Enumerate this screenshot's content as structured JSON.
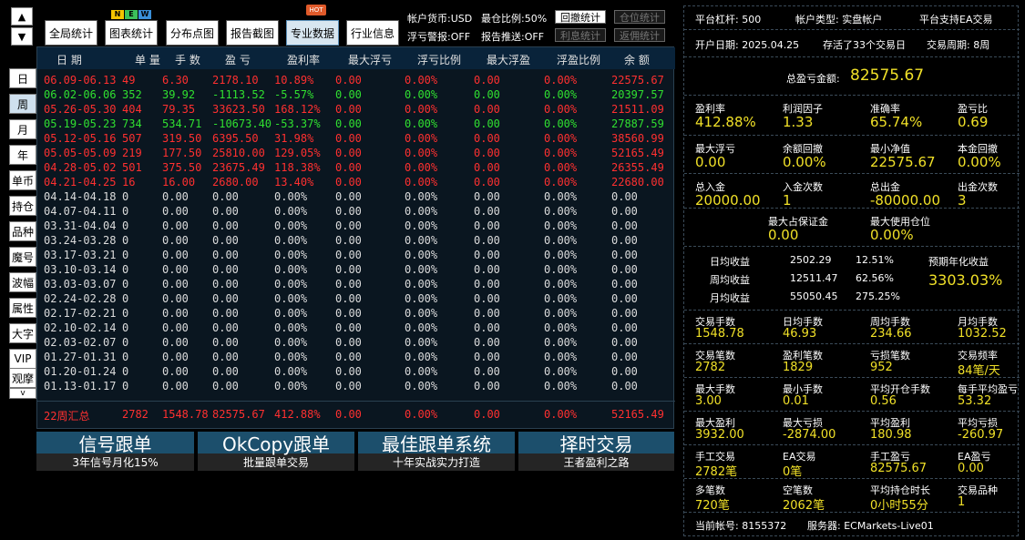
{
  "nav": {
    "up": "▲",
    "down": "▼",
    "items": [
      "日",
      "周",
      "月",
      "年",
      "单币",
      "持仓",
      "品种",
      "魔号",
      "波幅",
      "属性",
      "大字",
      "VIP",
      "观摩"
    ],
    "more": "v"
  },
  "toolbar": {
    "buttons": [
      "全局统计",
      "图表统计",
      "分布点图",
      "报告截图",
      "专业数据",
      "行业信息"
    ],
    "new_badge": [
      "N",
      "E",
      "W"
    ],
    "hot_badge": "HOT",
    "currency": "帐户货币:USD",
    "max_position": "最仓比例:50%",
    "float_alert": "浮亏警报:OFF",
    "report_push": "报告推送:OFF",
    "small_buttons": [
      "回撤统计",
      "仓位统计",
      "利息统计",
      "返佣统计"
    ]
  },
  "table": {
    "headers": [
      "日 期",
      "单 量",
      "手 数",
      "盈 亏",
      "盈利率",
      "最大浮亏",
      "浮亏比例",
      "最大浮盈",
      "浮盈比例",
      "余 额"
    ],
    "rows": [
      {
        "date": "06.09-06.13",
        "orders": "49",
        "lots": "6.30",
        "pl": "2178.10",
        "rate": "10.89%",
        "mdd": "0.00",
        "ddr": "0.00%",
        "mfp": "0.00",
        "fpr": "0.00%",
        "bal": "22575.67",
        "color": "red"
      },
      {
        "date": "06.02-06.06",
        "orders": "352",
        "lots": "39.92",
        "pl": "-1113.52",
        "rate": "-5.57%",
        "mdd": "0.00",
        "ddr": "0.00%",
        "mfp": "0.00",
        "fpr": "0.00%",
        "bal": "20397.57",
        "color": "green"
      },
      {
        "date": "05.26-05.30",
        "orders": "404",
        "lots": "79.35",
        "pl": "33623.50",
        "rate": "168.12%",
        "mdd": "0.00",
        "ddr": "0.00%",
        "mfp": "0.00",
        "fpr": "0.00%",
        "bal": "21511.09",
        "color": "red"
      },
      {
        "date": "05.19-05.23",
        "orders": "734",
        "lots": "534.71",
        "pl": "-10673.40",
        "rate": "-53.37%",
        "mdd": "0.00",
        "ddr": "0.00%",
        "mfp": "0.00",
        "fpr": "0.00%",
        "bal": "27887.59",
        "color": "green"
      },
      {
        "date": "05.12-05.16",
        "orders": "507",
        "lots": "319.50",
        "pl": "6395.50",
        "rate": "31.98%",
        "mdd": "0.00",
        "ddr": "0.00%",
        "mfp": "0.00",
        "fpr": "0.00%",
        "bal": "38560.99",
        "color": "red"
      },
      {
        "date": "05.05-05.09",
        "orders": "219",
        "lots": "177.50",
        "pl": "25810.00",
        "rate": "129.05%",
        "mdd": "0.00",
        "ddr": "0.00%",
        "mfp": "0.00",
        "fpr": "0.00%",
        "bal": "52165.49",
        "color": "red"
      },
      {
        "date": "04.28-05.02",
        "orders": "501",
        "lots": "375.50",
        "pl": "23675.49",
        "rate": "118.38%",
        "mdd": "0.00",
        "ddr": "0.00%",
        "mfp": "0.00",
        "fpr": "0.00%",
        "bal": "26355.49",
        "color": "red"
      },
      {
        "date": "04.21-04.25",
        "orders": "16",
        "lots": "16.00",
        "pl": "2680.00",
        "rate": "13.40%",
        "mdd": "0.00",
        "ddr": "0.00%",
        "mfp": "0.00",
        "fpr": "0.00%",
        "bal": "22680.00",
        "color": "red"
      },
      {
        "date": "04.14-04.18",
        "orders": "0",
        "lots": "0.00",
        "pl": "0.00",
        "rate": "0.00%",
        "mdd": "0.00",
        "ddr": "0.00%",
        "mfp": "0.00",
        "fpr": "0.00%",
        "bal": "0.00",
        "color": "white"
      },
      {
        "date": "04.07-04.11",
        "orders": "0",
        "lots": "0.00",
        "pl": "0.00",
        "rate": "0.00%",
        "mdd": "0.00",
        "ddr": "0.00%",
        "mfp": "0.00",
        "fpr": "0.00%",
        "bal": "0.00",
        "color": "white"
      },
      {
        "date": "03.31-04.04",
        "orders": "0",
        "lots": "0.00",
        "pl": "0.00",
        "rate": "0.00%",
        "mdd": "0.00",
        "ddr": "0.00%",
        "mfp": "0.00",
        "fpr": "0.00%",
        "bal": "0.00",
        "color": "white"
      },
      {
        "date": "03.24-03.28",
        "orders": "0",
        "lots": "0.00",
        "pl": "0.00",
        "rate": "0.00%",
        "mdd": "0.00",
        "ddr": "0.00%",
        "mfp": "0.00",
        "fpr": "0.00%",
        "bal": "0.00",
        "color": "white"
      },
      {
        "date": "03.17-03.21",
        "orders": "0",
        "lots": "0.00",
        "pl": "0.00",
        "rate": "0.00%",
        "mdd": "0.00",
        "ddr": "0.00%",
        "mfp": "0.00",
        "fpr": "0.00%",
        "bal": "0.00",
        "color": "white"
      },
      {
        "date": "03.10-03.14",
        "orders": "0",
        "lots": "0.00",
        "pl": "0.00",
        "rate": "0.00%",
        "mdd": "0.00",
        "ddr": "0.00%",
        "mfp": "0.00",
        "fpr": "0.00%",
        "bal": "0.00",
        "color": "white"
      },
      {
        "date": "03.03-03.07",
        "orders": "0",
        "lots": "0.00",
        "pl": "0.00",
        "rate": "0.00%",
        "mdd": "0.00",
        "ddr": "0.00%",
        "mfp": "0.00",
        "fpr": "0.00%",
        "bal": "0.00",
        "color": "white"
      },
      {
        "date": "02.24-02.28",
        "orders": "0",
        "lots": "0.00",
        "pl": "0.00",
        "rate": "0.00%",
        "mdd": "0.00",
        "ddr": "0.00%",
        "mfp": "0.00",
        "fpr": "0.00%",
        "bal": "0.00",
        "color": "white"
      },
      {
        "date": "02.17-02.21",
        "orders": "0",
        "lots": "0.00",
        "pl": "0.00",
        "rate": "0.00%",
        "mdd": "0.00",
        "ddr": "0.00%",
        "mfp": "0.00",
        "fpr": "0.00%",
        "bal": "0.00",
        "color": "white"
      },
      {
        "date": "02.10-02.14",
        "orders": "0",
        "lots": "0.00",
        "pl": "0.00",
        "rate": "0.00%",
        "mdd": "0.00",
        "ddr": "0.00%",
        "mfp": "0.00",
        "fpr": "0.00%",
        "bal": "0.00",
        "color": "white"
      },
      {
        "date": "02.03-02.07",
        "orders": "0",
        "lots": "0.00",
        "pl": "0.00",
        "rate": "0.00%",
        "mdd": "0.00",
        "ddr": "0.00%",
        "mfp": "0.00",
        "fpr": "0.00%",
        "bal": "0.00",
        "color": "white"
      },
      {
        "date": "01.27-01.31",
        "orders": "0",
        "lots": "0.00",
        "pl": "0.00",
        "rate": "0.00%",
        "mdd": "0.00",
        "ddr": "0.00%",
        "mfp": "0.00",
        "fpr": "0.00%",
        "bal": "0.00",
        "color": "white"
      },
      {
        "date": "01.20-01.24",
        "orders": "0",
        "lots": "0.00",
        "pl": "0.00",
        "rate": "0.00%",
        "mdd": "0.00",
        "ddr": "0.00%",
        "mfp": "0.00",
        "fpr": "0.00%",
        "bal": "0.00",
        "color": "white"
      },
      {
        "date": "01.13-01.17",
        "orders": "0",
        "lots": "0.00",
        "pl": "0.00",
        "rate": "0.00%",
        "mdd": "0.00",
        "ddr": "0.00%",
        "mfp": "0.00",
        "fpr": "0.00%",
        "bal": "0.00",
        "color": "white"
      }
    ],
    "summary": {
      "date": "22周汇总",
      "orders": "2782",
      "lots": "1548.78",
      "pl": "82575.67",
      "rate": "412.88%",
      "mdd": "0.00",
      "ddr": "0.00%",
      "mfp": "0.00",
      "fpr": "0.00%",
      "bal": "52165.49"
    }
  },
  "promos": [
    {
      "title": "信号跟单",
      "sub": "3年信号月化15%"
    },
    {
      "title": "OkCopy跟单",
      "sub": "批量跟单交易"
    },
    {
      "title": "最佳跟单系统",
      "sub": "十年实战实力打造"
    },
    {
      "title": "择时交易",
      "sub": "王者盈利之路"
    }
  ],
  "right": {
    "leverage": "平台杠杆:  500",
    "account_type": "帐户类型:  实盘帐户",
    "ea_support": "平台支持EA交易",
    "open_date": "开户日期:  2025.04.25",
    "alive": "存活了33个交易日",
    "cycle": "交易周期:  8周",
    "total_pl_label": "总盈亏金额:",
    "total_pl": "82575.67",
    "stats": [
      {
        "label": "盈利率",
        "value": "412.88%"
      },
      {
        "label": "利润因子",
        "value": "1.33"
      },
      {
        "label": "准确率",
        "value": "65.74%"
      },
      {
        "label": "盈亏比",
        "value": "0.69"
      },
      {
        "label": "最大浮亏",
        "value": "0.00"
      },
      {
        "label": "余额回撤",
        "value": "0.00%"
      },
      {
        "label": "最小净值",
        "value": "22575.67"
      },
      {
        "label": "本金回撤",
        "value": "0.00%"
      },
      {
        "label": "总入金",
        "value": "20000.00"
      },
      {
        "label": "入金次数",
        "value": "1"
      },
      {
        "label": "总出金",
        "value": "-80000.00"
      },
      {
        "label": "出金次数",
        "value": "3"
      },
      {
        "label": "最大占保证金",
        "value": "0.00"
      },
      {
        "label": "最大使用仓位",
        "value": "0.00%"
      }
    ],
    "income": [
      {
        "label": "日均收益",
        "amount": "2502.29",
        "pct": "12.51%"
      },
      {
        "label": "周均收益",
        "amount": "12511.47",
        "pct": "62.56%"
      },
      {
        "label": "月均收益",
        "amount": "55050.45",
        "pct": "275.25%"
      }
    ],
    "annual_label": "预期年化收益",
    "annual_value": "3303.03%",
    "stats2": [
      {
        "label": "交易手数",
        "value": "1548.78"
      },
      {
        "label": "日均手数",
        "value": "46.93"
      },
      {
        "label": "周均手数",
        "value": "234.66"
      },
      {
        "label": "月均手数",
        "value": "1032.52"
      },
      {
        "label": "交易笔数",
        "value": "2782"
      },
      {
        "label": "盈利笔数",
        "value": "1829"
      },
      {
        "label": "亏损笔数",
        "value": "952"
      },
      {
        "label": "交易频率",
        "value": "84笔/天"
      },
      {
        "label": "最大手数",
        "value": "3.00"
      },
      {
        "label": "最小手数",
        "value": "0.01"
      },
      {
        "label": "平均开仓手数",
        "value": "0.56"
      },
      {
        "label": "每手平均盈亏",
        "value": "53.32"
      },
      {
        "label": "最大盈利",
        "value": "3932.00"
      },
      {
        "label": "最大亏损",
        "value": "-2874.00"
      },
      {
        "label": "平均盈利",
        "value": "180.98"
      },
      {
        "label": "平均亏损",
        "value": "-260.97"
      },
      {
        "label": "手工交易",
        "value": "2782笔"
      },
      {
        "label": "EA交易",
        "value": "0笔"
      },
      {
        "label": "手工盈亏",
        "value": "82575.67"
      },
      {
        "label": "EA盈亏",
        "value": "0.00"
      },
      {
        "label": "多笔数",
        "value": "720笔"
      },
      {
        "label": "空笔数",
        "value": "2062笔"
      },
      {
        "label": "平均持仓时长",
        "value": "0小时55分"
      },
      {
        "label": "交易品种",
        "value": "1"
      }
    ],
    "account": "当前帐号:  8155372",
    "server": "服务器:  ECMarkets-Live01"
  }
}
